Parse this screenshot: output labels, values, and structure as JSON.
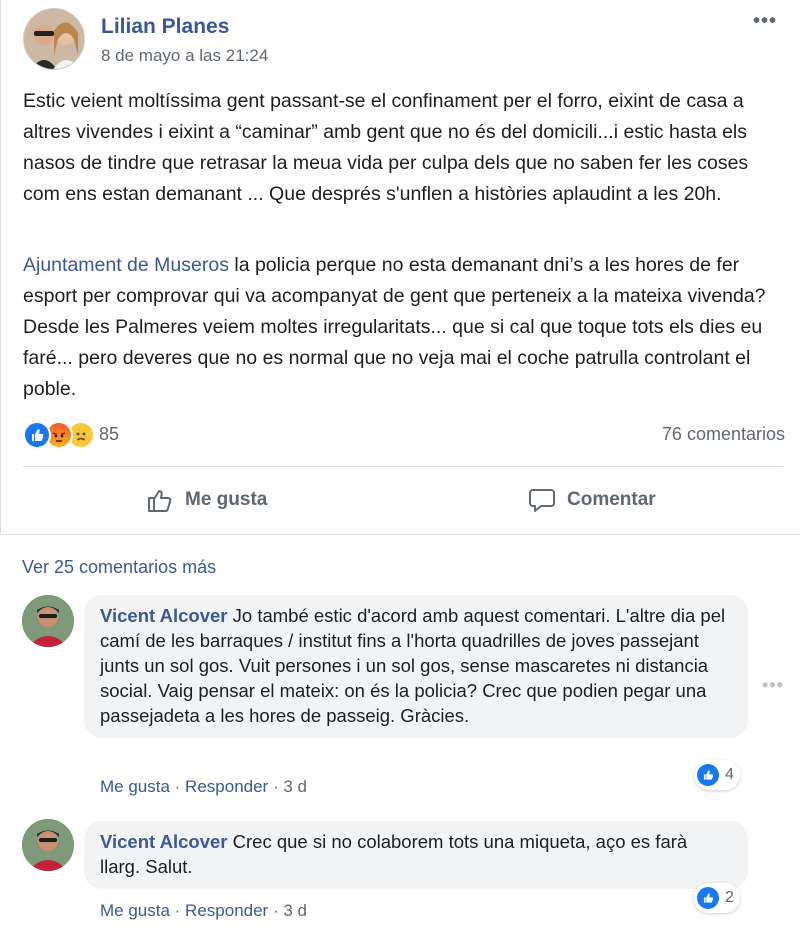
{
  "post": {
    "author": "Lilian Planes",
    "date": "8 de mayo a las 21:24",
    "more_label": "•••",
    "paragraph1": "Estic veient moltíssima gent passant-se el confinament per el forro, eixint de casa a altres vivendes i eixint a “caminar” amb gent que no és del domicili...i estic hasta els nasos de tindre que retrasar la meua vida per culpa dels que no saben fer les coses com ens estan demanant ... Que després s'unflen a històries aplaudint a les 20h.",
    "mention": "Ajuntament de Museros",
    "paragraph2_rest": " la policia perque no esta demanant dni’s a les hores de fer esport per comprovar qui va acompanyat de gent que perteneix a la mateixa vivenda? Desde les Palmeres veiem moltes irregularitats... que si cal que toque tots els dies eu faré... pero deveres que no es normal que no veja mai el coche patrulla controlant el poble.",
    "reactions": {
      "icons": [
        "like-icon",
        "angry-icon",
        "sad-icon"
      ],
      "count": "85"
    },
    "comments_count": "76 comentarios",
    "actions": {
      "like_label": "Me gusta",
      "comment_label": "Comentar"
    }
  },
  "comments_section": {
    "view_more": "Ver 25 comentarios más",
    "comments": [
      {
        "author": "Vicent Alcover",
        "text": " Jo també estic d'acord amb aquest comentari. L'altre dia pel camí de les barraques / institut fins a l'horta quadrilles de joves passejant junts un sol gos. Vuit persones i un sol gos, sense mascaretes ni distancia social. Vaig pensar el mateix: on és la policia? Crec que podien pegar una passejadeta a les hores de passeig. Gràcies.",
        "like_label": "Me gusta",
        "separator": " · ",
        "reply_label": "Responder",
        "time": "3 d",
        "reactions": "4",
        "more_label": "•••"
      },
      {
        "author": "Vicent Alcover",
        "text": " Crec que si no colaborem tots una miqueta, aço es farà llarg. Salut.",
        "like_label": "Me gusta",
        "separator": " · ",
        "reply_label": "Responder",
        "time": "3 d",
        "reactions": "2"
      }
    ]
  },
  "colors": {
    "link": "#385898",
    "secondary_text": "#606770",
    "like_blue": "#1877f2",
    "bubble_bg": "#f2f3f5"
  }
}
